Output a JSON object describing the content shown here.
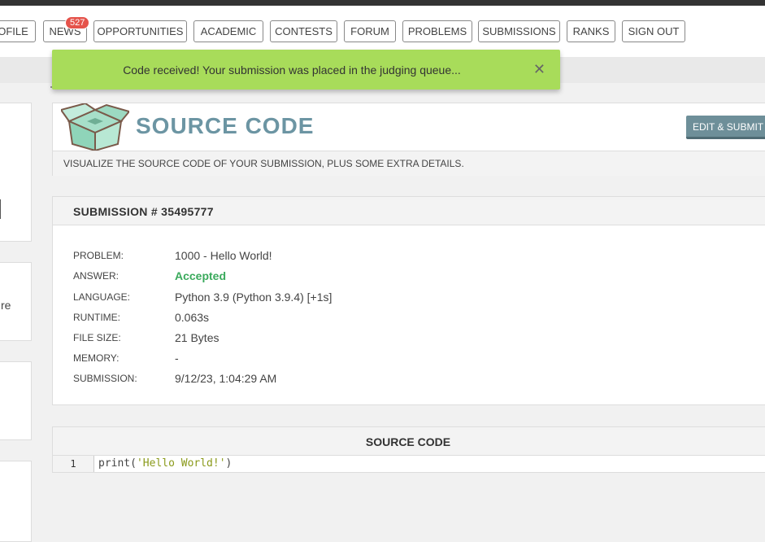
{
  "nav": {
    "items": [
      {
        "key": "profile",
        "label": "OFILE"
      },
      {
        "key": "news",
        "label": "NEWS",
        "badge": "527"
      },
      {
        "key": "opportunities",
        "label": "OPPORTUNITIES"
      },
      {
        "key": "academic",
        "label": "ACADEMIC"
      },
      {
        "key": "contests",
        "label": "CONTESTS"
      },
      {
        "key": "forum",
        "label": "FORUM"
      },
      {
        "key": "problems",
        "label": "PROBLEMS"
      },
      {
        "key": "submissions",
        "label": "SUBMISSIONS"
      },
      {
        "key": "ranks",
        "label": "RANKS"
      },
      {
        "key": "signout",
        "label": "SIGN OUT"
      }
    ]
  },
  "toast": {
    "message": "Code received! Your submission was placed in the judging queue...",
    "close": "✕"
  },
  "header": {
    "title": "SOURCE CODE",
    "edit_button": "EDIT & SUBMIT",
    "description": "VISUALIZE THE SOURCE CODE OF YOUR SUBMISSION, PLUS SOME EXTRA DETAILS."
  },
  "sidebar": {
    "cut_text": "re"
  },
  "submission": {
    "title": "SUBMISSION # 35495777",
    "rows": [
      {
        "label": "PROBLEM:",
        "value": "1000 - Hello World!"
      },
      {
        "label": "ANSWER:",
        "value": "Accepted"
      },
      {
        "label": "LANGUAGE:",
        "value": "Python 3.9 (Python 3.9.4) [+1s]"
      },
      {
        "label": "RUNTIME:",
        "value": "0.063s"
      },
      {
        "label": "FILE SIZE:",
        "value": "21 Bytes"
      },
      {
        "label": "MEMORY:",
        "value": "-"
      },
      {
        "label": "SUBMISSION:",
        "value": "9/12/23, 1:04:29 AM"
      }
    ]
  },
  "source": {
    "title": "SOURCE CODE",
    "line_number": "1",
    "code_fn": "print(",
    "code_str": "'Hello World!'",
    "code_end": ")"
  },
  "colors": {
    "toast_bg": "#a8dc5a",
    "accepted": "#3aaa5c",
    "title": "#6c95a3",
    "badge": "#e5534b",
    "edit_button": "#6e8f99"
  }
}
